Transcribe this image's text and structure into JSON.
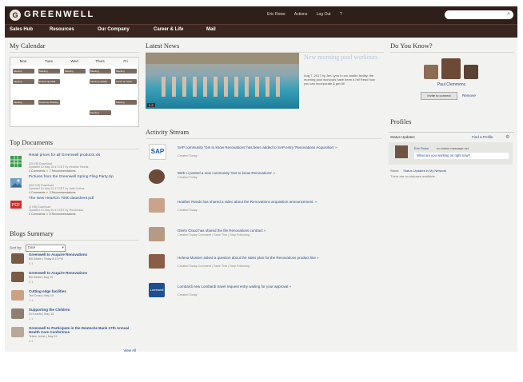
{
  "brand": "GREENWELL",
  "topbar": {
    "links": [
      "Eric Rowe",
      "Actions",
      "Log Out"
    ]
  },
  "nav": [
    "Sales Hub",
    "Resources",
    "Our Company",
    "Career & Life",
    "Mail"
  ],
  "calendar": {
    "title": "My Calendar",
    "days": [
      "Mon",
      "Tues",
      "Wed",
      "Thurs",
      "Fri"
    ],
    "events": [
      {
        "day": 0,
        "row": 0,
        "t": "Meeting"
      },
      {
        "day": 1,
        "row": 0,
        "t": "Meeting"
      },
      {
        "day": 2,
        "row": 0,
        "t": "Meeting"
      },
      {
        "day": 3,
        "row": 0,
        "t": "Meeting"
      },
      {
        "day": 4,
        "row": 0,
        "t": "Meeting"
      },
      {
        "day": 0,
        "row": 1,
        "t": "Meeting"
      },
      {
        "day": 1,
        "row": 1,
        "t": "Project @ 9AM"
      },
      {
        "day": 3,
        "row": 1,
        "t": "Meeting Update"
      },
      {
        "day": 4,
        "row": 1,
        "t": "Lunch w/ Janet"
      },
      {
        "day": 0,
        "row": 3,
        "t": "Meeting"
      },
      {
        "day": 1,
        "row": 3,
        "t": "Customer Briefing"
      },
      {
        "day": 4,
        "row": 3,
        "t": "Meeting"
      },
      {
        "day": 3,
        "row": 4,
        "t": "Meeting"
      }
    ]
  },
  "top_documents": {
    "title": "Top Documents",
    "items": [
      {
        "title": "Retail prices for all Greenwell products.xls",
        "meta": "(25 KB) Download",
        "updated": "Updated 10 May 15 47 EDT by Heather Reeds",
        "comments": "4 Comments",
        "recs": "7 Recommendations"
      },
      {
        "title": "Pictures from the Greenwell Spring Fling Party.zip",
        "meta": "(500 KB) Download",
        "updated": "Updated 10 May 15 47 EDT by Julie Collins",
        "comments": "4 Comments",
        "recs": "3 Recommendations"
      },
      {
        "title": "The New HeartOn 7000 datasheet.pdf",
        "meta": "(2 KB) Download",
        "updated": "Updated 10 May 15 47 EDT by Ted Amado",
        "comments": "2 Comments",
        "recs": "8 Recommendations"
      }
    ]
  },
  "blogs": {
    "title": "Blogs Summary",
    "sort_label": "Sort by:",
    "sort_value": "Date",
    "view_all": "View All",
    "items": [
      {
        "title": "Greenwell to Acquire Renovations",
        "meta": "Bill Adrale | Today 8:12 PM",
        "stats": "3   1"
      },
      {
        "title": "Greenwell to Acquire Renovations",
        "meta": "Bill Adrale | Aug 15",
        "stats": "3   1"
      },
      {
        "title": "Cutting edge facilities",
        "meta": "Ted Cross | May 15",
        "stats": "1   1"
      },
      {
        "title": "Supporting the Children",
        "meta": "Ed Kravitz | May 15",
        "stats": "1   1"
      },
      {
        "title": "Greenwell to Participate in the Deutsche Bank 17th Annual Health Care Conference",
        "meta": "Tellsm Jerlak | May 15",
        "stats": "4   1"
      }
    ]
  },
  "news": {
    "title": "Latest News",
    "headline": "New morning pool workouts",
    "text": "Aug 7, 2017 by Jen Lynn In our Austin facility, the morning pool workouts have been a hit! Read how you can incorporate & get fit!"
  },
  "activity": {
    "title": "Activity Stream",
    "items": [
      {
        "who": "SAP",
        "text": "SAP community 'Get to know Renovations' has been added to SAP entry 'Renovations Acquisition' »",
        "meta": "Created Today"
      },
      {
        "who": "Web Li",
        "text": "Web Li posted a new community 'Get to know Renovations' »",
        "meta": "Created Today"
      },
      {
        "who": "Heather Reeds",
        "text": "Heather Reeds has shared a video about the Renovations acquisition announcement. »",
        "meta": "Created Today"
      },
      {
        "who": "Glenn Cloud",
        "text": "Glenn Cloud has shared the file Renovations contract »",
        "meta": "Created Today  Comment | Save This | Stop Following"
      },
      {
        "who": "Helena Mussier",
        "text": "Helena Mussier asked a question about the sales plan for the Renovations product line »",
        "meta": "Created Today  Comment | Save This | Stop Following"
      },
      {
        "who": "Lombardi",
        "text": "Lombardi new Lombardi travel request entry waiting for your approval »",
        "meta": "Created Today"
      }
    ]
  },
  "know": {
    "title": "Do You Know?",
    "person": "Paul Clemmons",
    "invite": "Invite to connect",
    "remove": "Remove"
  },
  "profiles": {
    "title": "Profiles",
    "tab": "Status Updates",
    "find": "Find a Profile",
    "user": "Eric Rowe",
    "status": "no status message set",
    "prompt": "What are you working on right now?",
    "show_label": "Show:",
    "show_value": "Status Updates in My Network",
    "empty": "There are no statuses available"
  }
}
